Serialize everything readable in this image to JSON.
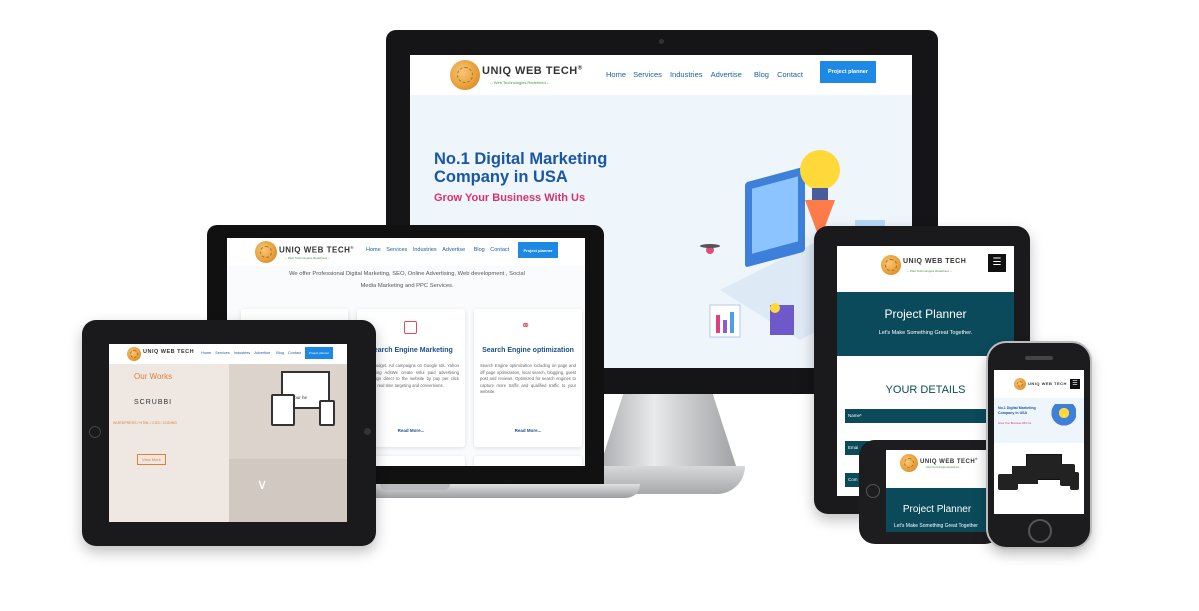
{
  "brand": {
    "name": "UNIQ WEB TECH",
    "trademark": "®",
    "tagline": "-- Web Technologies Redefined --"
  },
  "nav": {
    "items": [
      "Home",
      "Services",
      "Industries",
      "Advertise",
      "Blog",
      "Contact"
    ],
    "cta": "Project planner"
  },
  "hero": {
    "title_line1": "No.1 Digital Marketing",
    "title_line2": "Company in USA",
    "subtitle": "Grow Your Business With Us"
  },
  "laptop": {
    "intro": "We offer Professional Digital Marketing, SEO, Online Advertising, Web development , Social Media Marketing and PPC Services.",
    "cards": [
      {
        "title": "",
        "text": "",
        "more": ""
      },
      {
        "title": "Search Engine Marketing",
        "text": "ently budget. Ad campaigns on Google rds. Yahoo and Bing AdsWe create ssful paid advertising campaign direct to the website by pay per click include real time targeting and conversions.",
        "more": "Read More..."
      },
      {
        "title": "Search Engine optimization",
        "text": "Search Engine optimization including on page and off page optimization, local search, blogging, guest post and reviews. Optimized for search engines to capture more traffic and qualified traffic to your website.",
        "more": "Read More..."
      }
    ]
  },
  "tablet_left": {
    "section_title": "Our Works",
    "project": "SCRUBBI",
    "tags": "WORDPRESS / HTML / CSS / CODING",
    "button": "View More",
    "preview_text": "your he"
  },
  "tablet_right": {
    "planner_title": "Project Planner",
    "planner_sub": "Let's Make Something Great Together.",
    "details_title": "YOUR DETAILS",
    "name_placeholder": "Name*",
    "email_placeholder": "Emai",
    "company_placeholder": "Com"
  },
  "phone_landscape": {
    "planner_title": "Project Planner",
    "planner_sub": "Let's Make Something Great Together"
  },
  "phone_portrait": {
    "hero_title": "No.1 Digital Marketing Company in USA",
    "hero_sub": "Grow Your Business With Us"
  },
  "colors": {
    "nav_link": "#1b5fa8",
    "cta": "#1e88e5",
    "hero_title": "#1a56a8",
    "hero_sub": "#d6336c",
    "planner_bg": "#0b4a5a",
    "works_orange": "#e0803a"
  }
}
